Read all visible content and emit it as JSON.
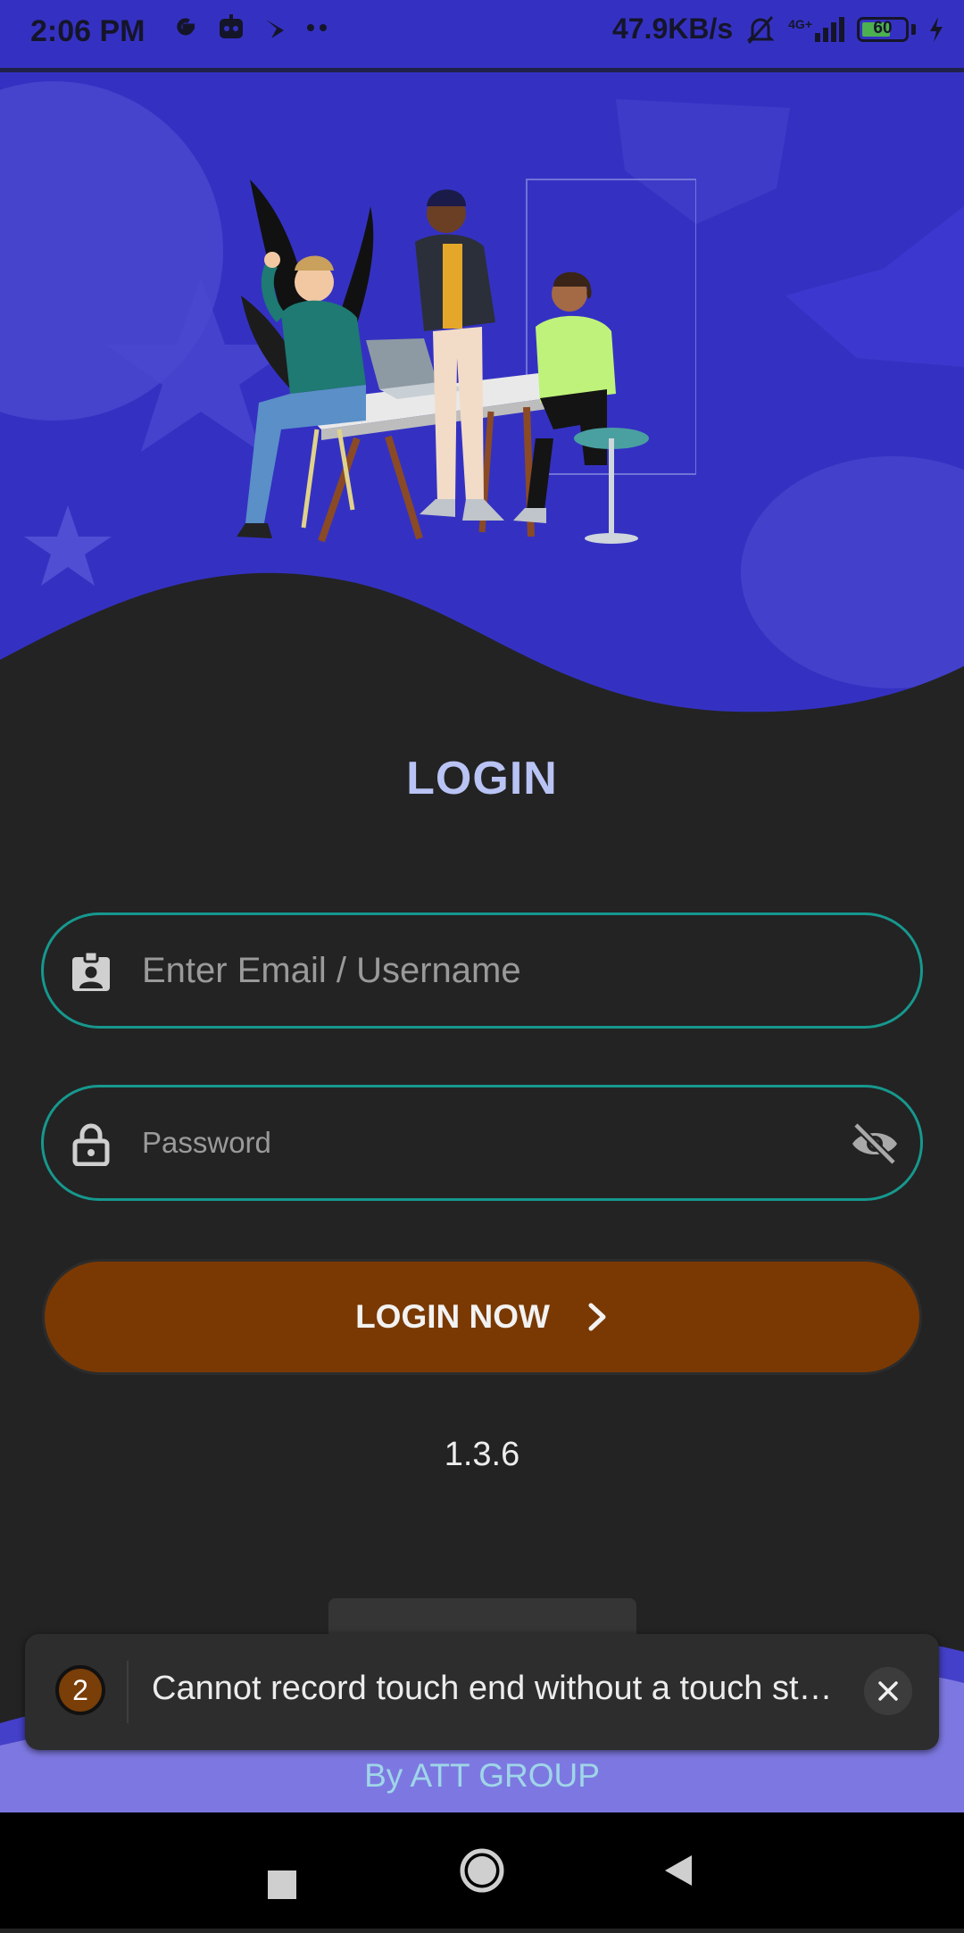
{
  "status_bar": {
    "time": "2:06 PM",
    "network_speed": "47.9KB/s",
    "network_type": "4G+",
    "battery_level": "60",
    "icons": [
      "google-icon",
      "ai-assistant-icon",
      "bird-icon",
      "more-dots-icon",
      "bell-muted-icon",
      "signal-icon",
      "battery-icon",
      "charging-icon"
    ]
  },
  "login": {
    "title": "LOGIN",
    "email_placeholder": "Enter Email / Username",
    "password_placeholder": "Password",
    "button_label": "LOGIN NOW",
    "version": "1.3.6"
  },
  "footer": {
    "credit": "By ATT GROUP"
  },
  "toast": {
    "count": "2",
    "message": "Cannot record touch end without a touch st…"
  },
  "colors": {
    "hero_blue": "#3431c2",
    "background": "#232323",
    "field_border": "#16988e",
    "button": "#7a3902",
    "title": "#b9c3f4"
  }
}
